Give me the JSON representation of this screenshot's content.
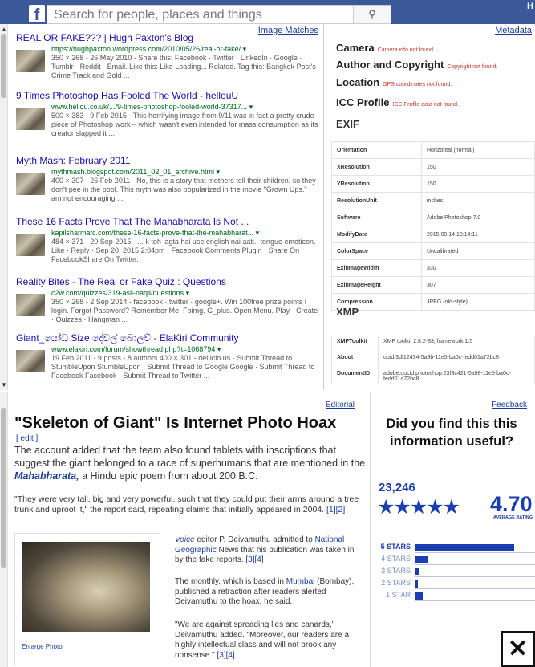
{
  "background": {
    "search_placeholder": "Search for people, places and things",
    "corner_text": "H"
  },
  "image_matches": {
    "label": "Image Matches",
    "results": [
      {
        "title": "REAL OR FAKE??? | Hugh Paxton's Blog",
        "url": "https://hughpaxton.wordpress.com/2010/05/26/real-or-fake/ ▾",
        "meta": "350 × 268 - 26 May 2010 - Share this: Facebook · Twitter · LinkedIn · Google · Tumblr · Reddit · Email. Like this: Like Loading... Related. Tag this: Bangkok Post's Crime Track and Gold ..."
      },
      {
        "title": "9 Times Photoshop Has Fooled The World - hellouU",
        "url": "www.hellou.co.uk/.../9-times-photoshop-fooled-world-37317... ▾",
        "meta": "500 × 383 - 9 Feb 2015 - This horrifying image from 9/11 was in fact a pretty crude piece of Photoshop work – which wasn't even intended for mass consumption as its creator slapped it ..."
      },
      {
        "title": "Myth Mash: February 2011",
        "url": "mythmash.blogspot.com/2011_02_01_archive.html ▾",
        "meta": "400 × 307 - 26 Feb 2011 - No, this is a story that mothers tell their children, so they don't pee in the pool. This myth was also popularized in the movie \"Grown Ups.\" I am not encouraging ..."
      },
      {
        "title": "These 16 Facts Prove That The Mahabharata Is Not ...",
        "url": "kapilsharmafc.com/these-16-facts-prove-that-the-mahabharat... ▾",
        "meta": "484 × 371 - 20 Sep 2015 - ... k toh lagta hai use english nai aati.. tongue emoticon. Like · Reply · Sep 20, 2015 2:04pm · Facebook Comments Plugin · Share On FacebookShare On Twitter."
      },
      {
        "title": "Reality Bites - The Real or Fake Quiz.: Questions",
        "url": "c2w.com/quizzes/319-asli-naqli/questions ▾",
        "meta": "350 × 268 - 2 Sep 2014 - facebook · twitter · google+. Win 100free prize points ! login. Forgot Password? Remember Me. Fbimg. G_plus. Open Menu. Play · Create · Quizzes · Hangman ..."
      },
      {
        "title": "Giant_යෝධ Size දේවල් බොලව් - ElaKiri Community",
        "url": "www.elakiri.com/forum/showthread.php?t=1068794 ▾",
        "meta": "19 Feb 2011 - 9 posts - 8 authors\n400 × 301 - del.icio.us · Submit Thread to StumbleUpon StumbleUpon · Submit Thread to Google Google · Submit Thread to Facebook Facebook · Submit Thread to Twitter ..."
      }
    ]
  },
  "metadata": {
    "label": "Metadata",
    "headings": [
      {
        "title": "Camera",
        "note": "Camera info not found."
      },
      {
        "title": "Author and Copyright",
        "note": "Copyright not found."
      },
      {
        "title": "Location",
        "note": "GPS coordinates not found."
      },
      {
        "title": "ICC Profile",
        "note": "ICC Profile data not found."
      }
    ],
    "exif_title": "EXIF",
    "exif_rows": [
      [
        "Orientation",
        "Horizontal (normal)"
      ],
      [
        "XResolution",
        "150"
      ],
      [
        "YResolution",
        "150"
      ],
      [
        "ResolutionUnit",
        "inches"
      ],
      [
        "Software",
        "Adobe Photoshop 7.0"
      ],
      [
        "ModifyDate",
        "2015:09:14 10:14:11"
      ],
      [
        "ColorSpace",
        "Uncalibrated"
      ],
      [
        "ExifImageWidth",
        "330"
      ],
      [
        "ExifImageHeight",
        "307"
      ],
      [
        "Compression",
        "JPEG (old-style)"
      ]
    ],
    "xmp_title": "XMP",
    "xmp_rows": [
      [
        "XMPToolkit",
        "XMP toolkit 2.8.2-33, framework 1.5"
      ],
      [
        "About",
        "uuid:3df12434-5a9b-11e5-ba0c-fedd01a72bc8"
      ],
      [
        "DocumentID",
        "adobe:docid:photoshop:23f3c421-5a98-11e5-ba0c-fedd01a72bc8"
      ]
    ]
  },
  "article": {
    "editorial_label": "Editorial",
    "title": "\"Skeleton of Giant\" Is Internet Photo Hoax",
    "edit_label": "[ edit ]",
    "p1_start": "The account added that the team also found tablets with inscriptions that suggest the giant belonged to a race of superhumans that are mentioned in the ",
    "p1_link": "Mahabharata,",
    "p1_end": " a Hindu epic poem from about 200 B.C.",
    "p2": "\"They were very tall, big and very powerful, such that they could put their arms around a tree trunk and uproot it,\" the report said, repeating claims that initially appeared in 2004.",
    "p2_refs": "[1][2]",
    "enlarge_label": "Enlarge Photo",
    "c1_link1": "Voice",
    "c1_text1": " editor P. Deivamuthu admitted to ",
    "c1_link2": "National Geographic",
    "c1_text2": " News that his publication was taken in by the fake reports. ",
    "c1_refs": "[3][4]",
    "c2_text1": "The monthly, which is based in ",
    "c2_link": "Mumbai",
    "c2_text2": " (Bombay), published a retraction after readers alerted Deivamuthu to the hoax, he said.",
    "c3_text": "\"We are against spreading lies and canards,\" Deivamuthu added. \"Moreover, our readers are a highly intellectual class and will not brook any nonsense.\" ",
    "c3_refs": "[3][4]"
  },
  "feedback": {
    "label": "Feedback",
    "question": "Did you find this this information useful?",
    "count": "23,246",
    "stars": "★★★★★",
    "rating": "4.70",
    "avg_label": "AVERAGE RATING",
    "rows": [
      {
        "label": "5 STARS",
        "fraction": 0.82
      },
      {
        "label": "4 STARS",
        "fraction": 0.1
      },
      {
        "label": "3 STARS",
        "fraction": 0.03
      },
      {
        "label": "2 STARS",
        "fraction": 0.02
      },
      {
        "label": "1 STAR",
        "fraction": 0.06
      }
    ],
    "close_symbol": "✕"
  },
  "colors": {
    "facebook_blue": "#3b5998",
    "rating_blue": "#1a3db0",
    "link_blue": "#1a0dab",
    "url_green": "#006621"
  }
}
